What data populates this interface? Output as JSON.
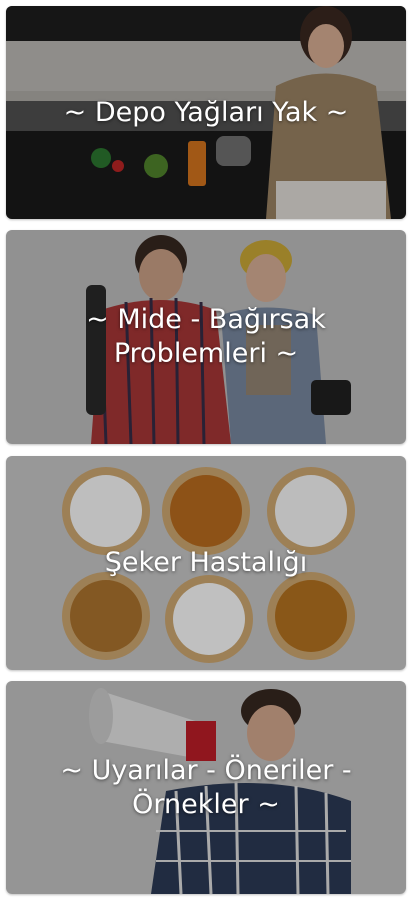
{
  "cards": [
    {
      "title": "~ Depo Yağları Yak ~",
      "image": "woman-kitchen-drinking"
    },
    {
      "title": "~ Mide - Bağırsak Problemleri ~",
      "image": "couple-stomach-ache"
    },
    {
      "title": "Şeker Hastalığı",
      "image": "sugar-bowls"
    },
    {
      "title": "~ Uyarılar - Öneriler - Örnekler ~",
      "image": "man-megaphone"
    }
  ]
}
